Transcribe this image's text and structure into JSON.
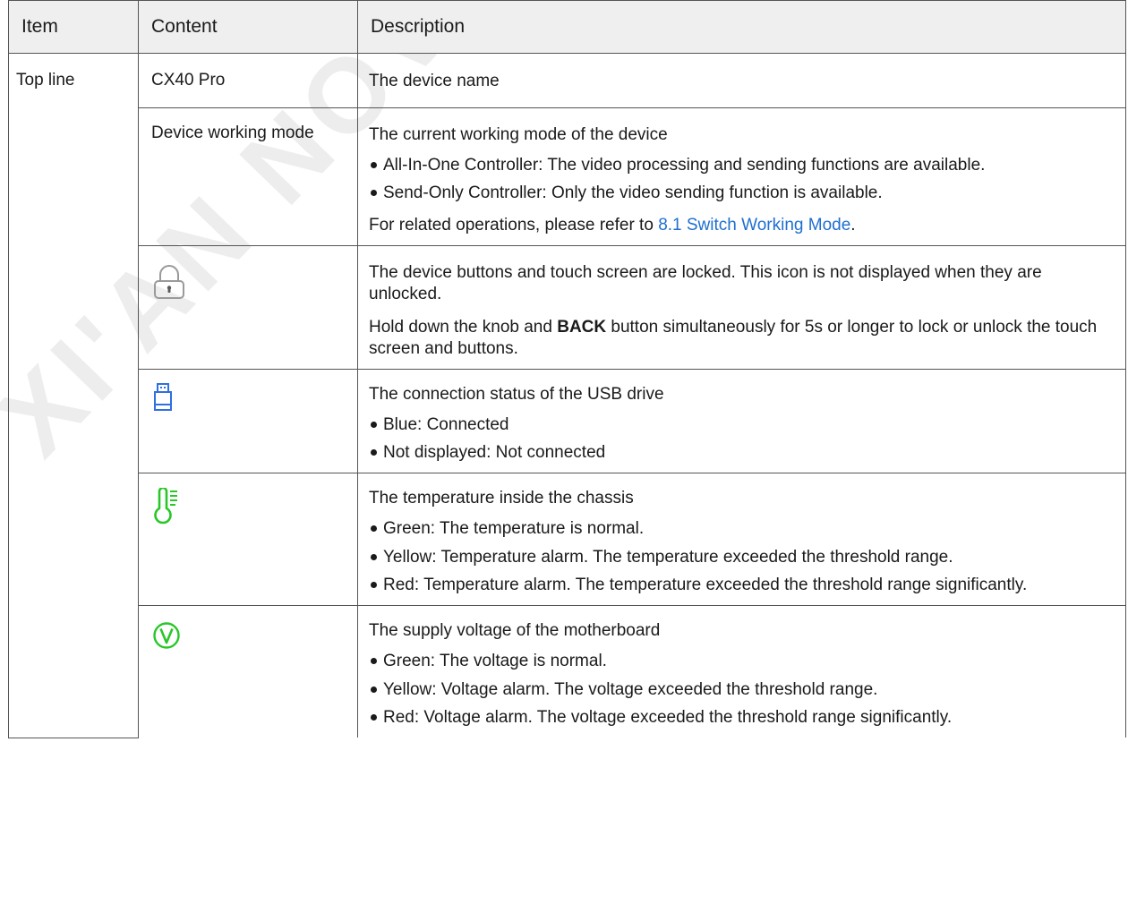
{
  "watermark": "XI'AN NOVASTAR",
  "headers": {
    "item": "Item",
    "content": "Content",
    "description": "Description"
  },
  "item_top_line": "Top line",
  "rows": [
    {
      "content": "CX40 Pro",
      "description": {
        "lead": "The device name"
      }
    },
    {
      "content": "Device working mode",
      "description": {
        "lead": "The current working mode of the device",
        "bullets": [
          "All-In-One Controller: The video processing and sending functions are available.",
          "Send-Only Controller: Only the video sending function is available."
        ],
        "note_prefix": "For related operations, please refer to ",
        "note_link": "8.1 Switch Working Mode",
        "note_suffix": "."
      }
    },
    {
      "icon": "lock-icon",
      "description": {
        "lead": "The device buttons and touch screen are locked. This icon is not displayed when they are unlocked.",
        "p2_pre": "Hold down the knob and ",
        "p2_bold": "BACK",
        "p2_post": " button simultaneously for 5s or longer to lock or unlock the touch screen and buttons."
      }
    },
    {
      "icon": "usb-drive-icon",
      "icon_color": "#2f6fe0",
      "description": {
        "lead": "The connection status of the USB drive",
        "bullets": [
          "Blue: Connected",
          "Not displayed: Not connected"
        ]
      }
    },
    {
      "icon": "thermometer-icon",
      "icon_color": "#28c728",
      "description": {
        "lead": "The temperature inside the chassis",
        "bullets": [
          "Green: The temperature is normal.",
          "Yellow: Temperature alarm. The temperature exceeded the threshold range.",
          "Red: Temperature alarm. The temperature exceeded the threshold range significantly."
        ]
      }
    },
    {
      "icon": "voltage-icon",
      "icon_color": "#28c728",
      "description": {
        "lead": "The supply voltage of the motherboard",
        "bullets": [
          "Green: The voltage is normal.",
          "Yellow: Voltage alarm. The voltage exceeded the threshold range.",
          "Red: Voltage alarm. The voltage exceeded the threshold range significantly."
        ]
      }
    }
  ]
}
